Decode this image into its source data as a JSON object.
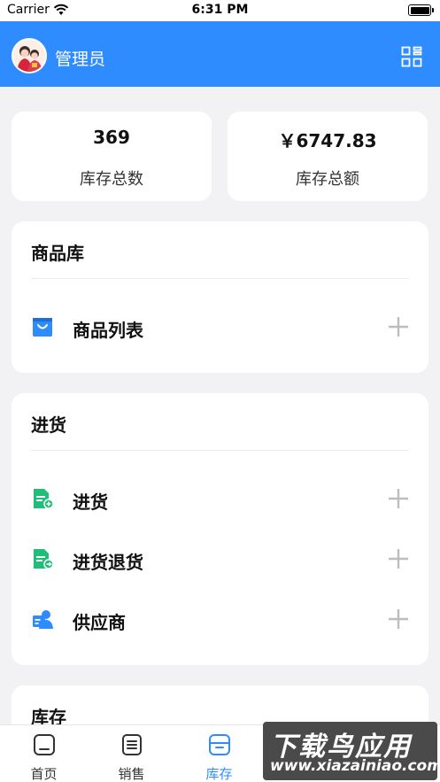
{
  "status_bar": {
    "carrier": "Carrier",
    "time": "6:31 PM"
  },
  "header": {
    "title": "管理员"
  },
  "stats": [
    {
      "value": "369",
      "label": "库存总数"
    },
    {
      "value": "￥6747.83",
      "label": "库存总额"
    }
  ],
  "sections": [
    {
      "title": "商品库",
      "items": [
        {
          "label": "商品列表",
          "icon": "shopping-bag-icon"
        }
      ]
    },
    {
      "title": "进货",
      "items": [
        {
          "label": "进货",
          "icon": "purchase-doc-icon"
        },
        {
          "label": "进货退货",
          "icon": "purchase-return-icon"
        },
        {
          "label": "供应商",
          "icon": "supplier-icon"
        }
      ]
    },
    {
      "title": "库存"
    }
  ],
  "tabs": [
    {
      "label": "首页",
      "icon": "home-icon"
    },
    {
      "label": "销售",
      "icon": "sales-icon"
    },
    {
      "label": "库存",
      "icon": "inventory-icon",
      "active": true
    }
  ],
  "watermark": {
    "title": "下载鸟应用",
    "url": "www.xiazainiao.com"
  },
  "colors": {
    "primary": "#2f8cff",
    "green": "#1fbf7a",
    "background": "#f2f2f4"
  }
}
